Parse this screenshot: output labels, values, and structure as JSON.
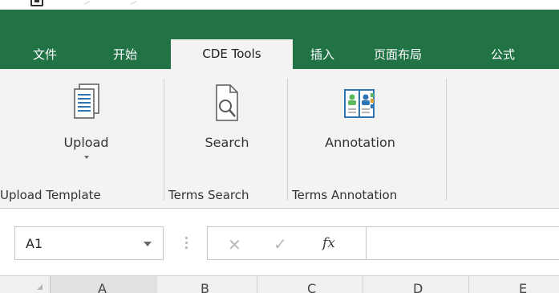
{
  "tabs": [
    "文件",
    "开始",
    "CDE Tools",
    "插入",
    "页面布局",
    "公式"
  ],
  "active_tab": "CDE Tools",
  "ribbon": {
    "buttons": [
      {
        "label": "Upload",
        "icon": "document-icon",
        "has_dropdown": true
      },
      {
        "label": "Search",
        "icon": "document-search-icon",
        "has_dropdown": false
      },
      {
        "label": "Annotation",
        "icon": "address-book-icon",
        "has_dropdown": false
      }
    ],
    "groups": [
      "Upload Template",
      "Terms Search",
      "Terms Annotation"
    ]
  },
  "formula_bar": {
    "name_box": "A1",
    "cancel_symbol": "✕",
    "enter_symbol": "✓",
    "fx_symbol": "fx",
    "formula_value": ""
  },
  "columns": [
    "A",
    "B",
    "C",
    "D",
    "E"
  ],
  "colors": {
    "ribbon_green": "#217346",
    "ribbon_body": "#f3f3f3",
    "book_blue": "#2e75b6",
    "book_green": "#5cb85c"
  }
}
